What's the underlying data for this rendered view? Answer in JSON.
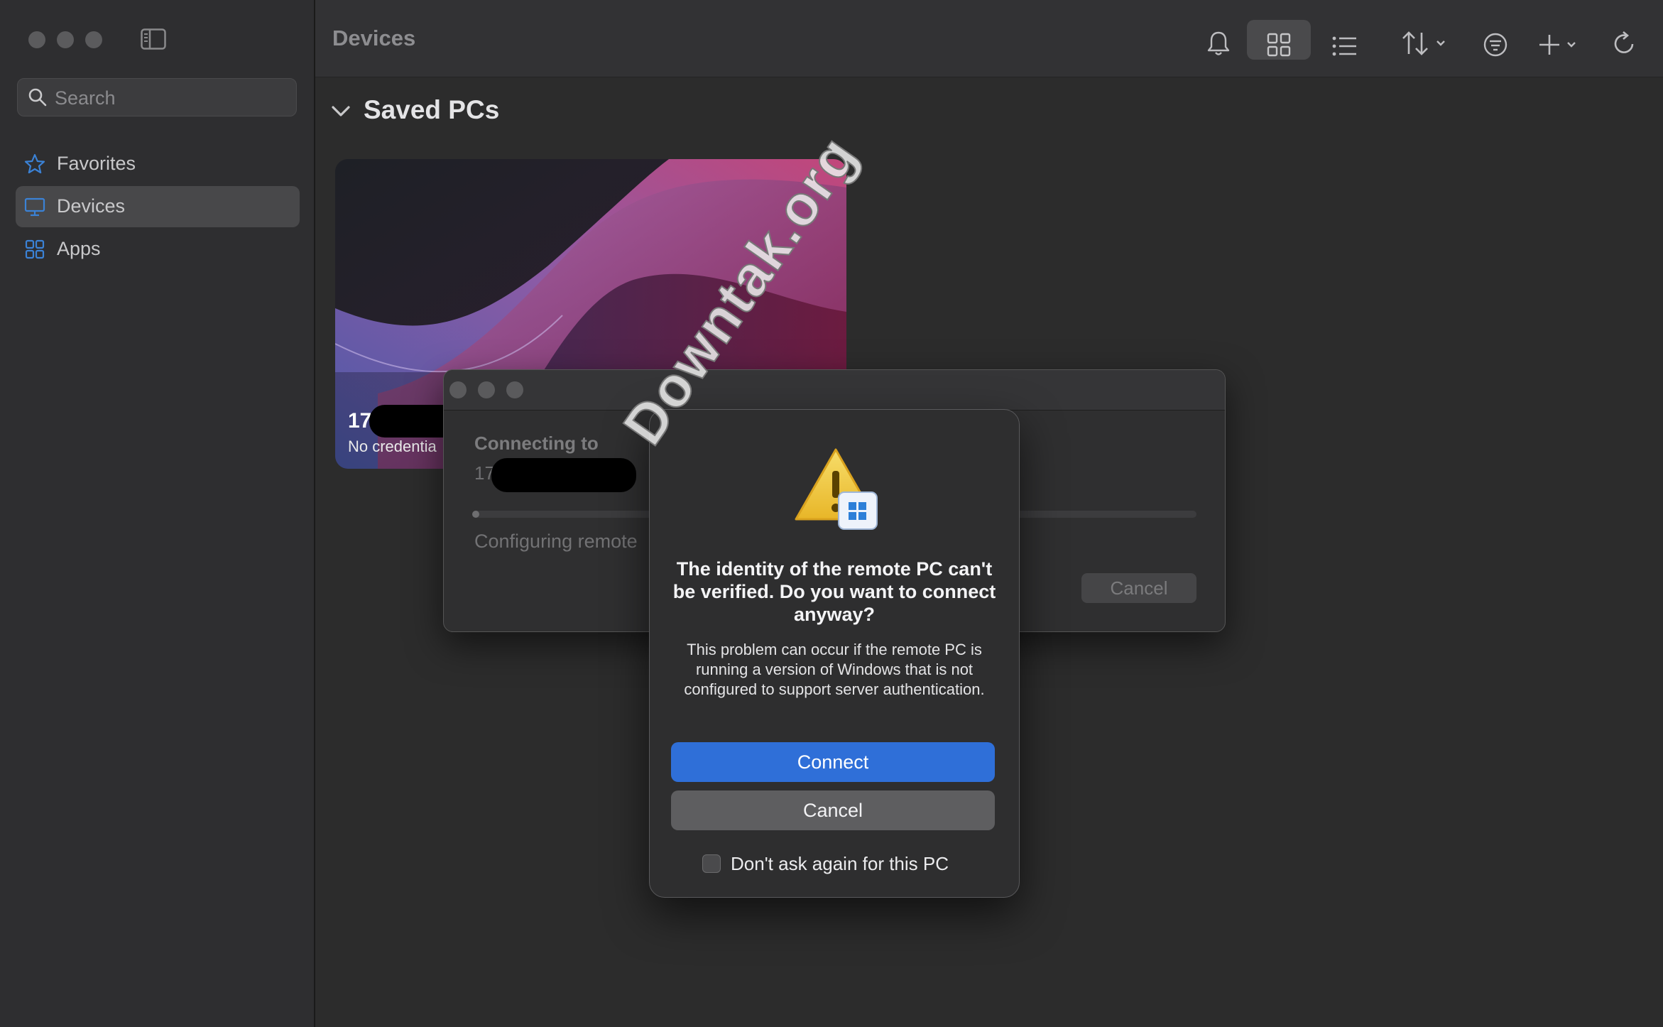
{
  "window": {
    "title": "Devices"
  },
  "sidebar": {
    "search_placeholder": "Search",
    "items": [
      {
        "label": "Favorites",
        "icon": "star-icon"
      },
      {
        "label": "Devices",
        "icon": "monitor-icon",
        "active": true
      },
      {
        "label": "Apps",
        "icon": "apps-grid-icon"
      }
    ]
  },
  "toolbar": {
    "icons": [
      "bell-icon",
      "grid-view-icon",
      "list-view-icon",
      "sort-icon",
      "filter-icon",
      "add-icon",
      "refresh-icon"
    ]
  },
  "main": {
    "section_title": "Saved PCs",
    "pc": {
      "name": "17",
      "subtitle": "No credentia"
    }
  },
  "connecting": {
    "label": "Connecting to",
    "ip": "17",
    "status": "Configuring remote",
    "progress": 0.01,
    "cancel": "Cancel"
  },
  "alert": {
    "title": "The identity of the remote PC can't be verified. Do you want to connect anyway?",
    "message": "This problem can occur if the remote PC is running a version of Windows that is not configured to support server authentication.",
    "connect": "Connect",
    "cancel": "Cancel",
    "checkbox_label": "Don't ask again for this PC"
  },
  "watermark": "Downtak.org",
  "colors": {
    "accent": "#2f6fd8",
    "sidebar_bg": "#2e2e30",
    "main_bg": "#2c2c2c"
  }
}
